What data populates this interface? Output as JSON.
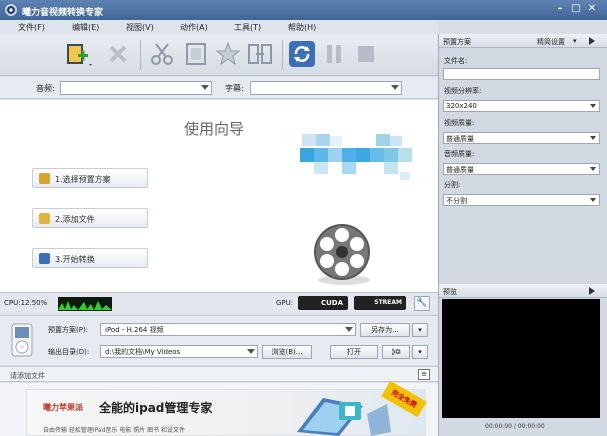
{
  "window": {
    "title": "曦力音视频转换专家"
  },
  "menu": [
    "文件(F)",
    "编辑(E)",
    "视图(V)",
    "动作(A)",
    "工具(T)",
    "帮助(H)"
  ],
  "toolbar": {
    "add": "add-file-icon",
    "delete": "delete-icon",
    "cut": "cut-icon",
    "film": "film-icon",
    "star": "effects-icon",
    "merge": "merge-icon",
    "convert": "convert-icon",
    "pause": "pause-icon",
    "stop": "stop-icon"
  },
  "audio_label": "音频:",
  "subtitle_label": "字幕:",
  "guide": {
    "title": "使用向导",
    "steps": [
      "1.选择预置方案",
      "2.添加文件",
      "3.开始转换"
    ]
  },
  "status": {
    "cpu": "CPU:12.50%",
    "gpu": "GPU:",
    "cuda": "CUDA",
    "stream": "STREAM"
  },
  "output": {
    "preset_label": "预置方案(P):",
    "preset_value": "iPod - H.264 视频",
    "save_as": "另存为...",
    "dir_label": "输出目录(D):",
    "dir_value": "d:\\我的文档\\My Videos",
    "browse": "浏览(B)...",
    "open": "打开"
  },
  "filebar": {
    "label": "请添加文件"
  },
  "banner": {
    "brand": "曦力苹果派",
    "slogan": "全能的ipad管理专家",
    "sub": "自由传输  轻松管理iPad音乐  电影  照片  图书  和设文件",
    "badge": "完全免费"
  },
  "right_panel": {
    "header": "预置方案",
    "advanced": "精简设置",
    "filename_label": "文件名:",
    "resolution_label": "视频分辨率:",
    "resolution_value": "320x240",
    "video_quality_label": "视频质量:",
    "video_quality_value": "普通质量",
    "audio_quality_label": "音频质量:",
    "audio_quality_value": "普通质量",
    "split_label": "分割:",
    "split_value": "不分割",
    "preview_label": "预览",
    "time": "00:00:00 / 00:00:00"
  },
  "colors": {
    "titlebar": "#3f6597",
    "accent": "#3b6fb6",
    "banner_red": "#c0392b",
    "preview_bg": "#000000"
  }
}
